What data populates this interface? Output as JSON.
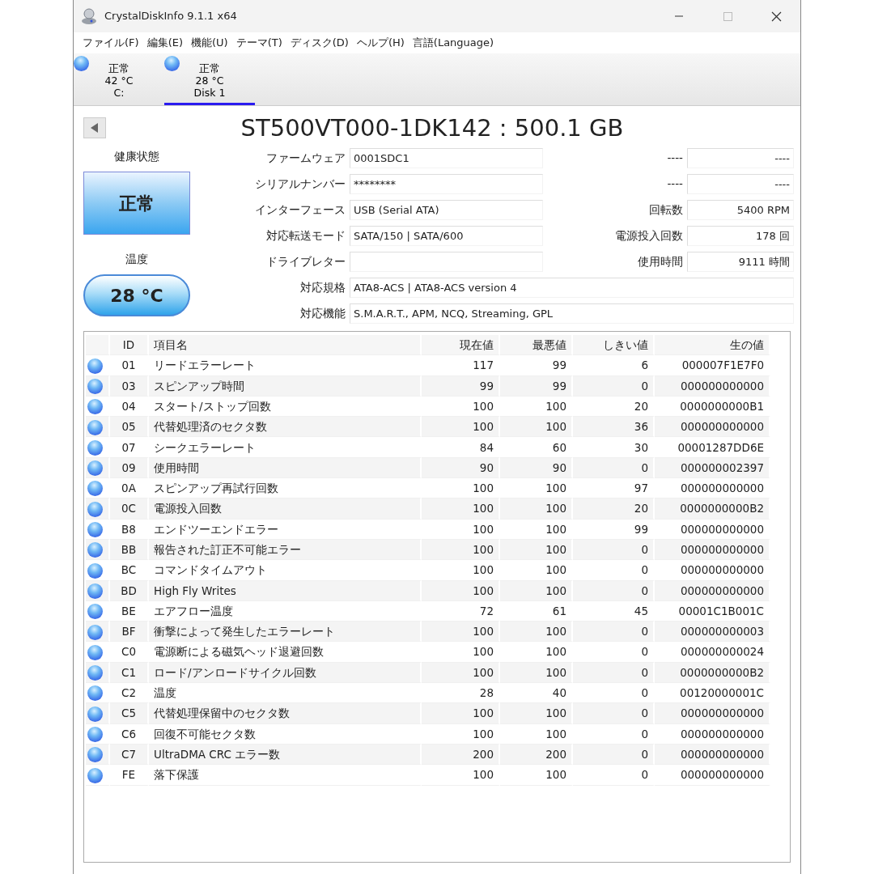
{
  "window": {
    "title": "CrystalDiskInfo 9.1.1 x64"
  },
  "menu": [
    "ファイル(F)",
    "編集(E)",
    "機能(U)",
    "テーマ(T)",
    "ディスク(D)",
    "ヘルプ(H)",
    "言語(Language)"
  ],
  "disks": [
    {
      "status": "正常",
      "temperature": "42 °C",
      "name": "C:",
      "selected": false
    },
    {
      "status": "正常",
      "temperature": "28 °C",
      "name": "Disk 1",
      "selected": true
    }
  ],
  "model": "ST500VT000-1DK142 : 500.1 GB",
  "health": {
    "label": "健康状態",
    "status": "正常"
  },
  "temperature": {
    "label": "温度",
    "value": "28 °C"
  },
  "fields": [
    {
      "label": "ファームウェア",
      "value": "0001SDC1"
    },
    {
      "label": "シリアルナンバー",
      "value": "********"
    },
    {
      "label": "インターフェース",
      "value": "USB (Serial ATA)"
    },
    {
      "label": "対応転送モード",
      "value": "SATA/150 | SATA/600"
    },
    {
      "label": "ドライブレター"
    }
  ],
  "side_fields": [
    {
      "label": "----",
      "value": "----"
    },
    {
      "label": "----",
      "value": "----"
    },
    {
      "label": "回転数",
      "value": "5400 RPM"
    },
    {
      "label": "電源投入回数",
      "value": "178 回"
    },
    {
      "label": "使用時間",
      "value": "9111 時間"
    }
  ],
  "wide_fields": [
    {
      "label": "対応規格",
      "value": "ATA8-ACS | ATA8-ACS version 4"
    },
    {
      "label": "対応機能",
      "value": "S.M.A.R.T., APM, NCQ, Streaming, GPL"
    }
  ],
  "smart": {
    "columns": [
      "ID",
      "項目名",
      "現在値",
      "最悪値",
      "しきい値",
      "生の値"
    ],
    "rows": [
      [
        "01",
        "リードエラーレート",
        "117",
        "99",
        "6",
        "000007F1E7F0"
      ],
      [
        "03",
        "スピンアップ時間",
        "99",
        "99",
        "0",
        "000000000000"
      ],
      [
        "04",
        "スタート/ストップ回数",
        "100",
        "100",
        "20",
        "0000000000B1"
      ],
      [
        "05",
        "代替処理済のセクタ数",
        "100",
        "100",
        "36",
        "000000000000"
      ],
      [
        "07",
        "シークエラーレート",
        "84",
        "60",
        "30",
        "00001287DD6E"
      ],
      [
        "09",
        "使用時間",
        "90",
        "90",
        "0",
        "000000002397"
      ],
      [
        "0A",
        "スピンアップ再試行回数",
        "100",
        "100",
        "97",
        "000000000000"
      ],
      [
        "0C",
        "電源投入回数",
        "100",
        "100",
        "20",
        "0000000000B2"
      ],
      [
        "B8",
        "エンドツーエンドエラー",
        "100",
        "100",
        "99",
        "000000000000"
      ],
      [
        "BB",
        "報告された訂正不可能エラー",
        "100",
        "100",
        "0",
        "000000000000"
      ],
      [
        "BC",
        "コマンドタイムアウト",
        "100",
        "100",
        "0",
        "000000000000"
      ],
      [
        "BD",
        "High Fly Writes",
        "100",
        "100",
        "0",
        "000000000000"
      ],
      [
        "BE",
        "エアフロー温度",
        "72",
        "61",
        "45",
        "00001C1B001C"
      ],
      [
        "BF",
        "衝撃によって発生したエラーレート",
        "100",
        "100",
        "0",
        "000000000003"
      ],
      [
        "C0",
        "電源断による磁気ヘッド退避回数",
        "100",
        "100",
        "0",
        "000000000024"
      ],
      [
        "C1",
        "ロード/アンロードサイクル回数",
        "100",
        "100",
        "0",
        "0000000000B2"
      ],
      [
        "C2",
        "温度",
        "28",
        "40",
        "0",
        "00120000001C"
      ],
      [
        "C5",
        "代替処理保留中のセクタ数",
        "100",
        "100",
        "0",
        "000000000000"
      ],
      [
        "C6",
        "回復不可能セクタ数",
        "100",
        "100",
        "0",
        "000000000000"
      ],
      [
        "C7",
        "UltraDMA CRC エラー数",
        "200",
        "200",
        "0",
        "000000000000"
      ],
      [
        "FE",
        "落下保護",
        "100",
        "100",
        "0",
        "000000000000"
      ]
    ]
  }
}
